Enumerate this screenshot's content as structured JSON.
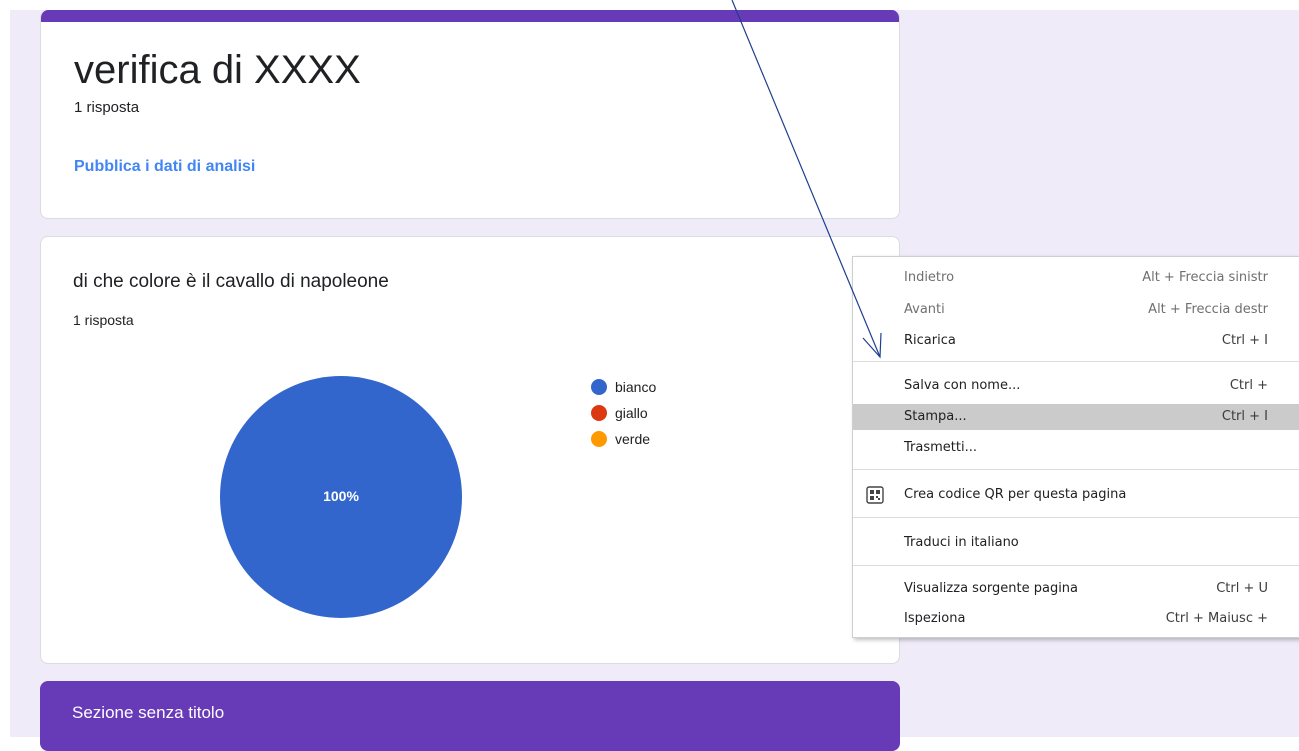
{
  "header": {
    "title": "verifica di XXXX",
    "response_count": "1 risposta",
    "publish_link": "Pubblica i dati di analisi"
  },
  "question": {
    "title": "di che colore è il cavallo di napoleone",
    "response_count": "1 risposta",
    "slice_label": "100%"
  },
  "chart_data": {
    "type": "pie",
    "categories": [
      "bianco",
      "giallo",
      "verde"
    ],
    "values": [
      100,
      0,
      0
    ],
    "colors": [
      "#3366cc",
      "#dc3912",
      "#ff9900"
    ],
    "data_labels": [
      "100%"
    ],
    "legend_position": "right"
  },
  "legend": [
    {
      "label": "bianco",
      "color": "#3366cc"
    },
    {
      "label": "giallo",
      "color": "#dc3912"
    },
    {
      "label": "verde",
      "color": "#ff9900"
    }
  ],
  "section": {
    "title": "Sezione senza titolo"
  },
  "context_menu": {
    "back_label": "Indietro",
    "back_shortcut": "Alt + Freccia sinistr",
    "forward_label": "Avanti",
    "forward_shortcut": "Alt + Freccia destr",
    "reload_label": "Ricarica",
    "reload_shortcut": "Ctrl + I",
    "save_label": "Salva con nome...",
    "save_shortcut": "Ctrl +",
    "print_label": "Stampa...",
    "print_shortcut": "Ctrl + I",
    "cast_label": "Trasmetti...",
    "qr_label": "Crea codice QR per questa pagina",
    "qr_icon": "qr-code-icon",
    "translate_label": "Traduci in italiano",
    "view_source_label": "Visualizza sorgente pagina",
    "view_source_shortcut": "Ctrl + U",
    "inspect_label": "Ispeziona",
    "inspect_shortcut": "Ctrl + Maiusc +"
  },
  "colors": {
    "accent": "#673ab7",
    "background": "#f0ebf8",
    "link": "#4285f4",
    "annotation_arrow": "#1f3f8f"
  }
}
